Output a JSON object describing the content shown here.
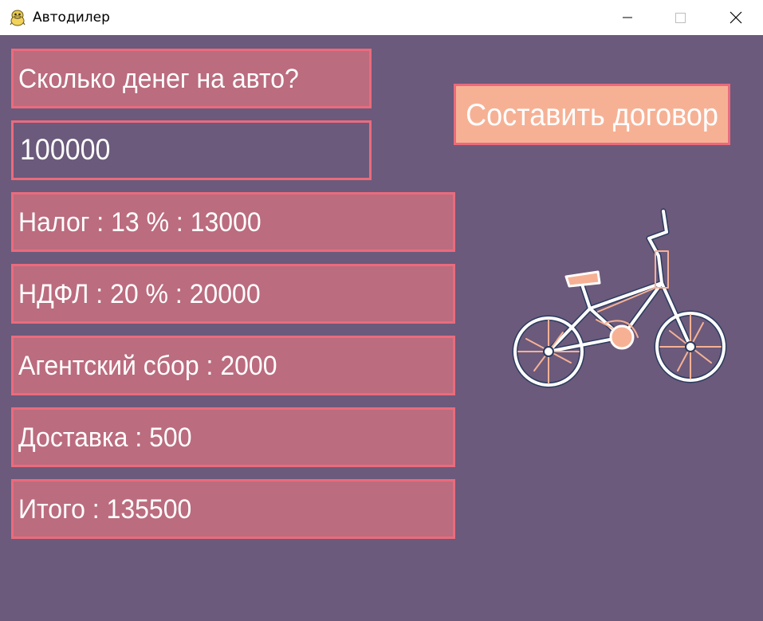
{
  "window": {
    "title": "Автодилер",
    "icon": "python-snake-icon"
  },
  "form": {
    "prompt_label": "Сколько денег на авто?",
    "amount_value": "100000"
  },
  "results": [
    "Налог : 13 % : 13000",
    "НДФЛ : 20 % : 20000",
    "Агентский сбор : 2000",
    "Доставка : 500",
    "Итого : 135500"
  ],
  "actions": {
    "contract_label": "Составить договор"
  },
  "image": {
    "icon": "bicycle-sketch"
  },
  "colors": {
    "background": "#6b5a7b",
    "box_fill": "#bb6c7e",
    "box_border": "#ea6b7d",
    "button_fill": "#f6b195",
    "text": "#ffffff"
  }
}
